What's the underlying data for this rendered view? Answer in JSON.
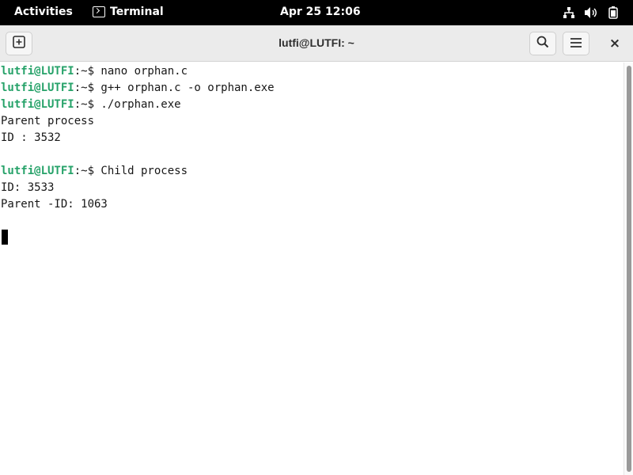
{
  "topbar": {
    "activities": "Activities",
    "app_name": "Terminal",
    "app_icon": "terminal-icon",
    "clock": "Apr 25  12:06",
    "tray_icons": [
      "network-icon",
      "volume-icon",
      "battery-icon"
    ]
  },
  "window": {
    "title": "lutfi@LUTFI: ~",
    "new_tab_icon": "new-tab-icon",
    "search_icon": "search-icon",
    "menu_icon": "hamburger-menu-icon",
    "close_label": "×"
  },
  "terminal": {
    "lines": [
      {
        "user": "lutfi@LUTFI",
        "rest": ":~$ nano orphan.c"
      },
      {
        "user": "lutfi@LUTFI",
        "rest": ":~$ g++ orphan.c -o orphan.exe"
      },
      {
        "user": "lutfi@LUTFI",
        "rest": ":~$ ./orphan.exe"
      },
      {
        "user": "",
        "rest": "Parent process"
      },
      {
        "user": "",
        "rest": "ID : 3532"
      },
      {
        "user": "",
        "rest": ""
      },
      {
        "user": "lutfi@LUTFI",
        "rest": ":~$ Child process"
      },
      {
        "user": "",
        "rest": "ID: 3533"
      },
      {
        "user": "",
        "rest": "Parent -ID: 1063"
      }
    ],
    "prompt_color": "#26a269"
  }
}
